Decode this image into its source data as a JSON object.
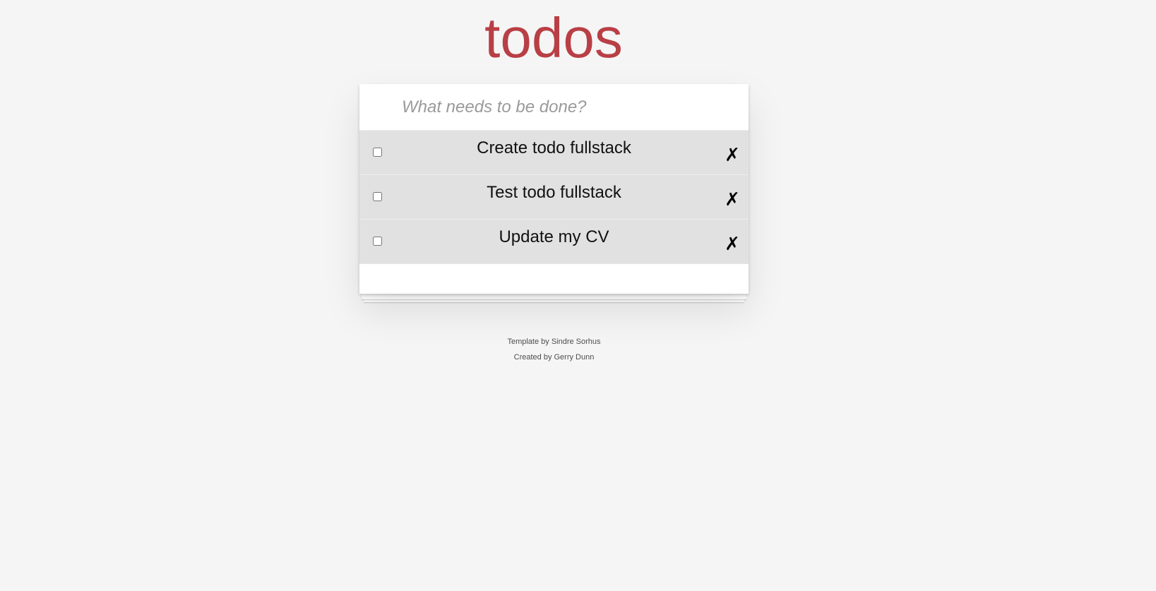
{
  "header": {
    "title": "todos"
  },
  "new_todo": {
    "placeholder": "What needs to be done?",
    "value": ""
  },
  "todos": [
    {
      "label": "Create todo fullstack",
      "completed": false,
      "delete_glyph": "✗"
    },
    {
      "label": "Test todo fullstack",
      "completed": false,
      "delete_glyph": "✗"
    },
    {
      "label": "Update my CV",
      "completed": false,
      "delete_glyph": "✗"
    }
  ],
  "info": {
    "template_credit": "Template by Sindre Sorhus",
    "created_credit": "Created by Gerry Dunn"
  },
  "colors": {
    "title": "#b83f45",
    "background": "#f5f5f5",
    "item_background": "#e1e1e1"
  }
}
